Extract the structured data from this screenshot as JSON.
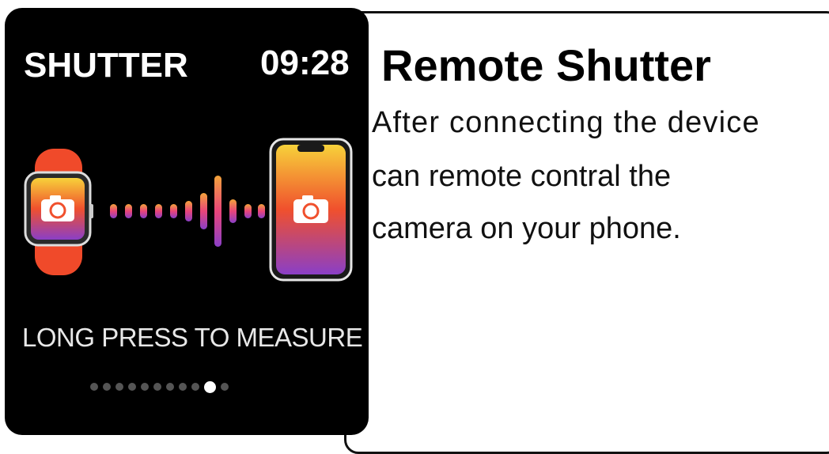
{
  "watch": {
    "title": "SHUTTER",
    "time": "09:28",
    "hint": "LONG PRESS TO MEASURE",
    "page_indicator": {
      "total": 11,
      "active": 10
    },
    "illustration": {
      "watch_icon": "camera-icon",
      "phone_icon": "camera-icon",
      "colors": {
        "band": "#f04a2a",
        "gradient_top": "#f7d23a",
        "gradient_mid": "#f0502d",
        "gradient_bottom": "#8a3fc7"
      }
    }
  },
  "feature": {
    "heading": "Remote Shutter",
    "description_lines": [
      "After connecting the device",
      "can remote contral the",
      "camera on your phone."
    ]
  }
}
